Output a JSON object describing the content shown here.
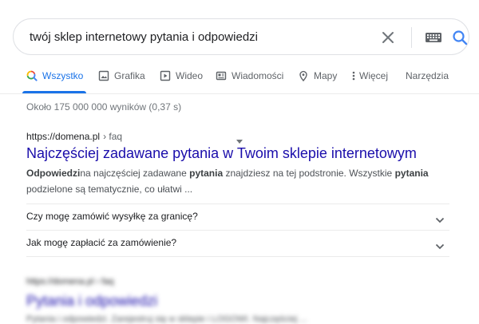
{
  "search": {
    "query": "twój sklep internetowy pytania i odpowiedzi",
    "clear_icon": "close-icon",
    "keyboard_icon": "keyboard-icon",
    "search_icon": "search-icon"
  },
  "tabs": [
    {
      "label": "Wszystko",
      "icon": "search-icon",
      "active": true
    },
    {
      "label": "Grafika",
      "icon": "image-icon",
      "active": false
    },
    {
      "label": "Wideo",
      "icon": "video-icon",
      "active": false
    },
    {
      "label": "Wiadomości",
      "icon": "news-icon",
      "active": false
    },
    {
      "label": "Mapy",
      "icon": "map-pin-icon",
      "active": false
    },
    {
      "label": "Więcej",
      "icon": "more-vert-icon",
      "active": false
    },
    {
      "label": "Narzędzia",
      "icon": "",
      "active": false
    }
  ],
  "stats": "Około 175 000 000 wyników (0,37 s)",
  "result": {
    "url": "https://domena.pl",
    "breadcrumb": "› faq",
    "title": "Najczęściej zadawane pytania w Twoim sklepie internetowym",
    "snippet": {
      "b1": "Odpowiedzi",
      "t1": "na najczęściej zadawane ",
      "b2": "pytania",
      "t2": " znajdziesz na tej podstronie. Wszystkie ",
      "b3": "pytania",
      "t3": " podzielone są tematycznie, co ułatwi ..."
    },
    "faqs": [
      "Czy mogę zamówić wysyłkę za granicę?",
      "Jak mogę zapłacić za zamówienie?"
    ]
  },
  "blurred_result": {
    "url": "https://domena.pl › faq",
    "title": "Pytania i odpowiedzi",
    "snippet": "Pytania i odpowiedzi. Zarejestruj się w sklepie i LOGOWI. Najczęściej ..."
  },
  "colors": {
    "accent": "#1a73e8",
    "link": "#1a0dab",
    "muted": "#70757a"
  }
}
